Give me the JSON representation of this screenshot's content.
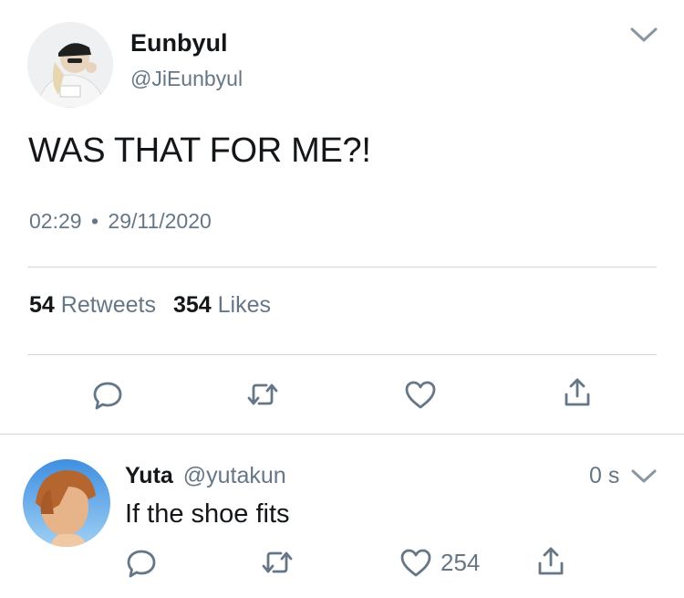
{
  "tweet": {
    "display_name": "Eunbyul",
    "handle": "@JiEunbyul",
    "text": "WAS THAT FOR ME?!",
    "time": "02:29",
    "separator": "•",
    "date": "29/11/2020",
    "retweet_count": "54",
    "retweet_label": "Retweets",
    "like_count": "354",
    "like_label": "Likes",
    "actions": [
      "reply-icon",
      "retweet-icon",
      "like-icon",
      "share-icon"
    ]
  },
  "reply": {
    "display_name": "Yuta",
    "handle": "@yutakun",
    "time": "0 s",
    "text": "If the shoe fits",
    "like_count": "254",
    "actions": [
      "reply-icon",
      "retweet-icon",
      "like-icon",
      "share-icon"
    ]
  },
  "colors": {
    "text": "#14171a",
    "secondary": "#657786",
    "divider": "#d2d6da"
  }
}
